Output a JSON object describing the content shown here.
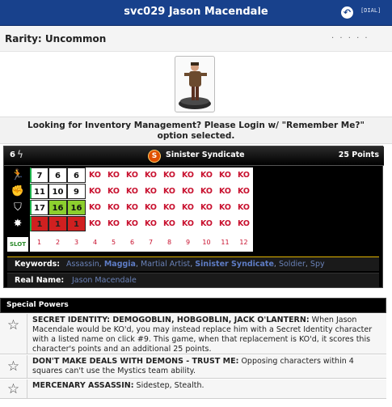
{
  "header": {
    "title": "svc029 Jason Macendale",
    "dial_link": "[DIAL]"
  },
  "rarity": {
    "label": "Rarity: Uncommon",
    "dots": "· · · · ·"
  },
  "login_message": "Looking for Inventory Management? Please Login w/ \"Remember Me?\" option selected.",
  "dial": {
    "range": "6",
    "team": "Sinister Syndicate",
    "points": "25 Points",
    "slot_label": "SLOT",
    "slot_numbers": [
      "1",
      "2",
      "3",
      "4",
      "5",
      "6",
      "7",
      "8",
      "9",
      "10",
      "11",
      "12"
    ],
    "rows": [
      [
        "7",
        "6",
        "6",
        "KO",
        "KO",
        "KO",
        "KO",
        "KO",
        "KO",
        "KO",
        "KO",
        "KO"
      ],
      [
        "11",
        "10",
        "9",
        "KO",
        "KO",
        "KO",
        "KO",
        "KO",
        "KO",
        "KO",
        "KO",
        "KO"
      ],
      [
        "17",
        "16",
        "16",
        "KO",
        "KO",
        "KO",
        "KO",
        "KO",
        "KO",
        "KO",
        "KO",
        "KO"
      ],
      [
        "1",
        "1",
        "1",
        "KO",
        "KO",
        "KO",
        "KO",
        "KO",
        "KO",
        "KO",
        "KO",
        "KO"
      ]
    ],
    "keywords_label": "Keywords:",
    "keywords": [
      "Assassin",
      "Maggia",
      "Martial Artist",
      "Sinister Syndicate",
      "Soldier",
      "Spy"
    ],
    "real_name_label": "Real Name:",
    "real_name": "Jason Macendale",
    "colors": {
      "ko_red": "#c8102e",
      "power_green": "#8ccf2e",
      "power_red": "#d02020"
    }
  },
  "special_powers": {
    "title": "Special Powers",
    "items": [
      {
        "name": "SECRET IDENTITY: DEMOGOBLIN, HOBGOBLIN, JACK O'LANTERN:",
        "text": "When Jason Macendale would be KO'd, you may instead replace him with a Secret Identity character with a listed name on click #9. This game, when that replacement is KO'd, it scores this character's points and an additional 25 points."
      },
      {
        "name": "DON'T MAKE DEALS WITH DEMONS - TRUST ME:",
        "text": "Opposing characters within 4 squares can't use the Mystics team ability."
      },
      {
        "name": "MERCENARY ASSASSIN:",
        "text": "Sidestep, Stealth."
      }
    ]
  }
}
